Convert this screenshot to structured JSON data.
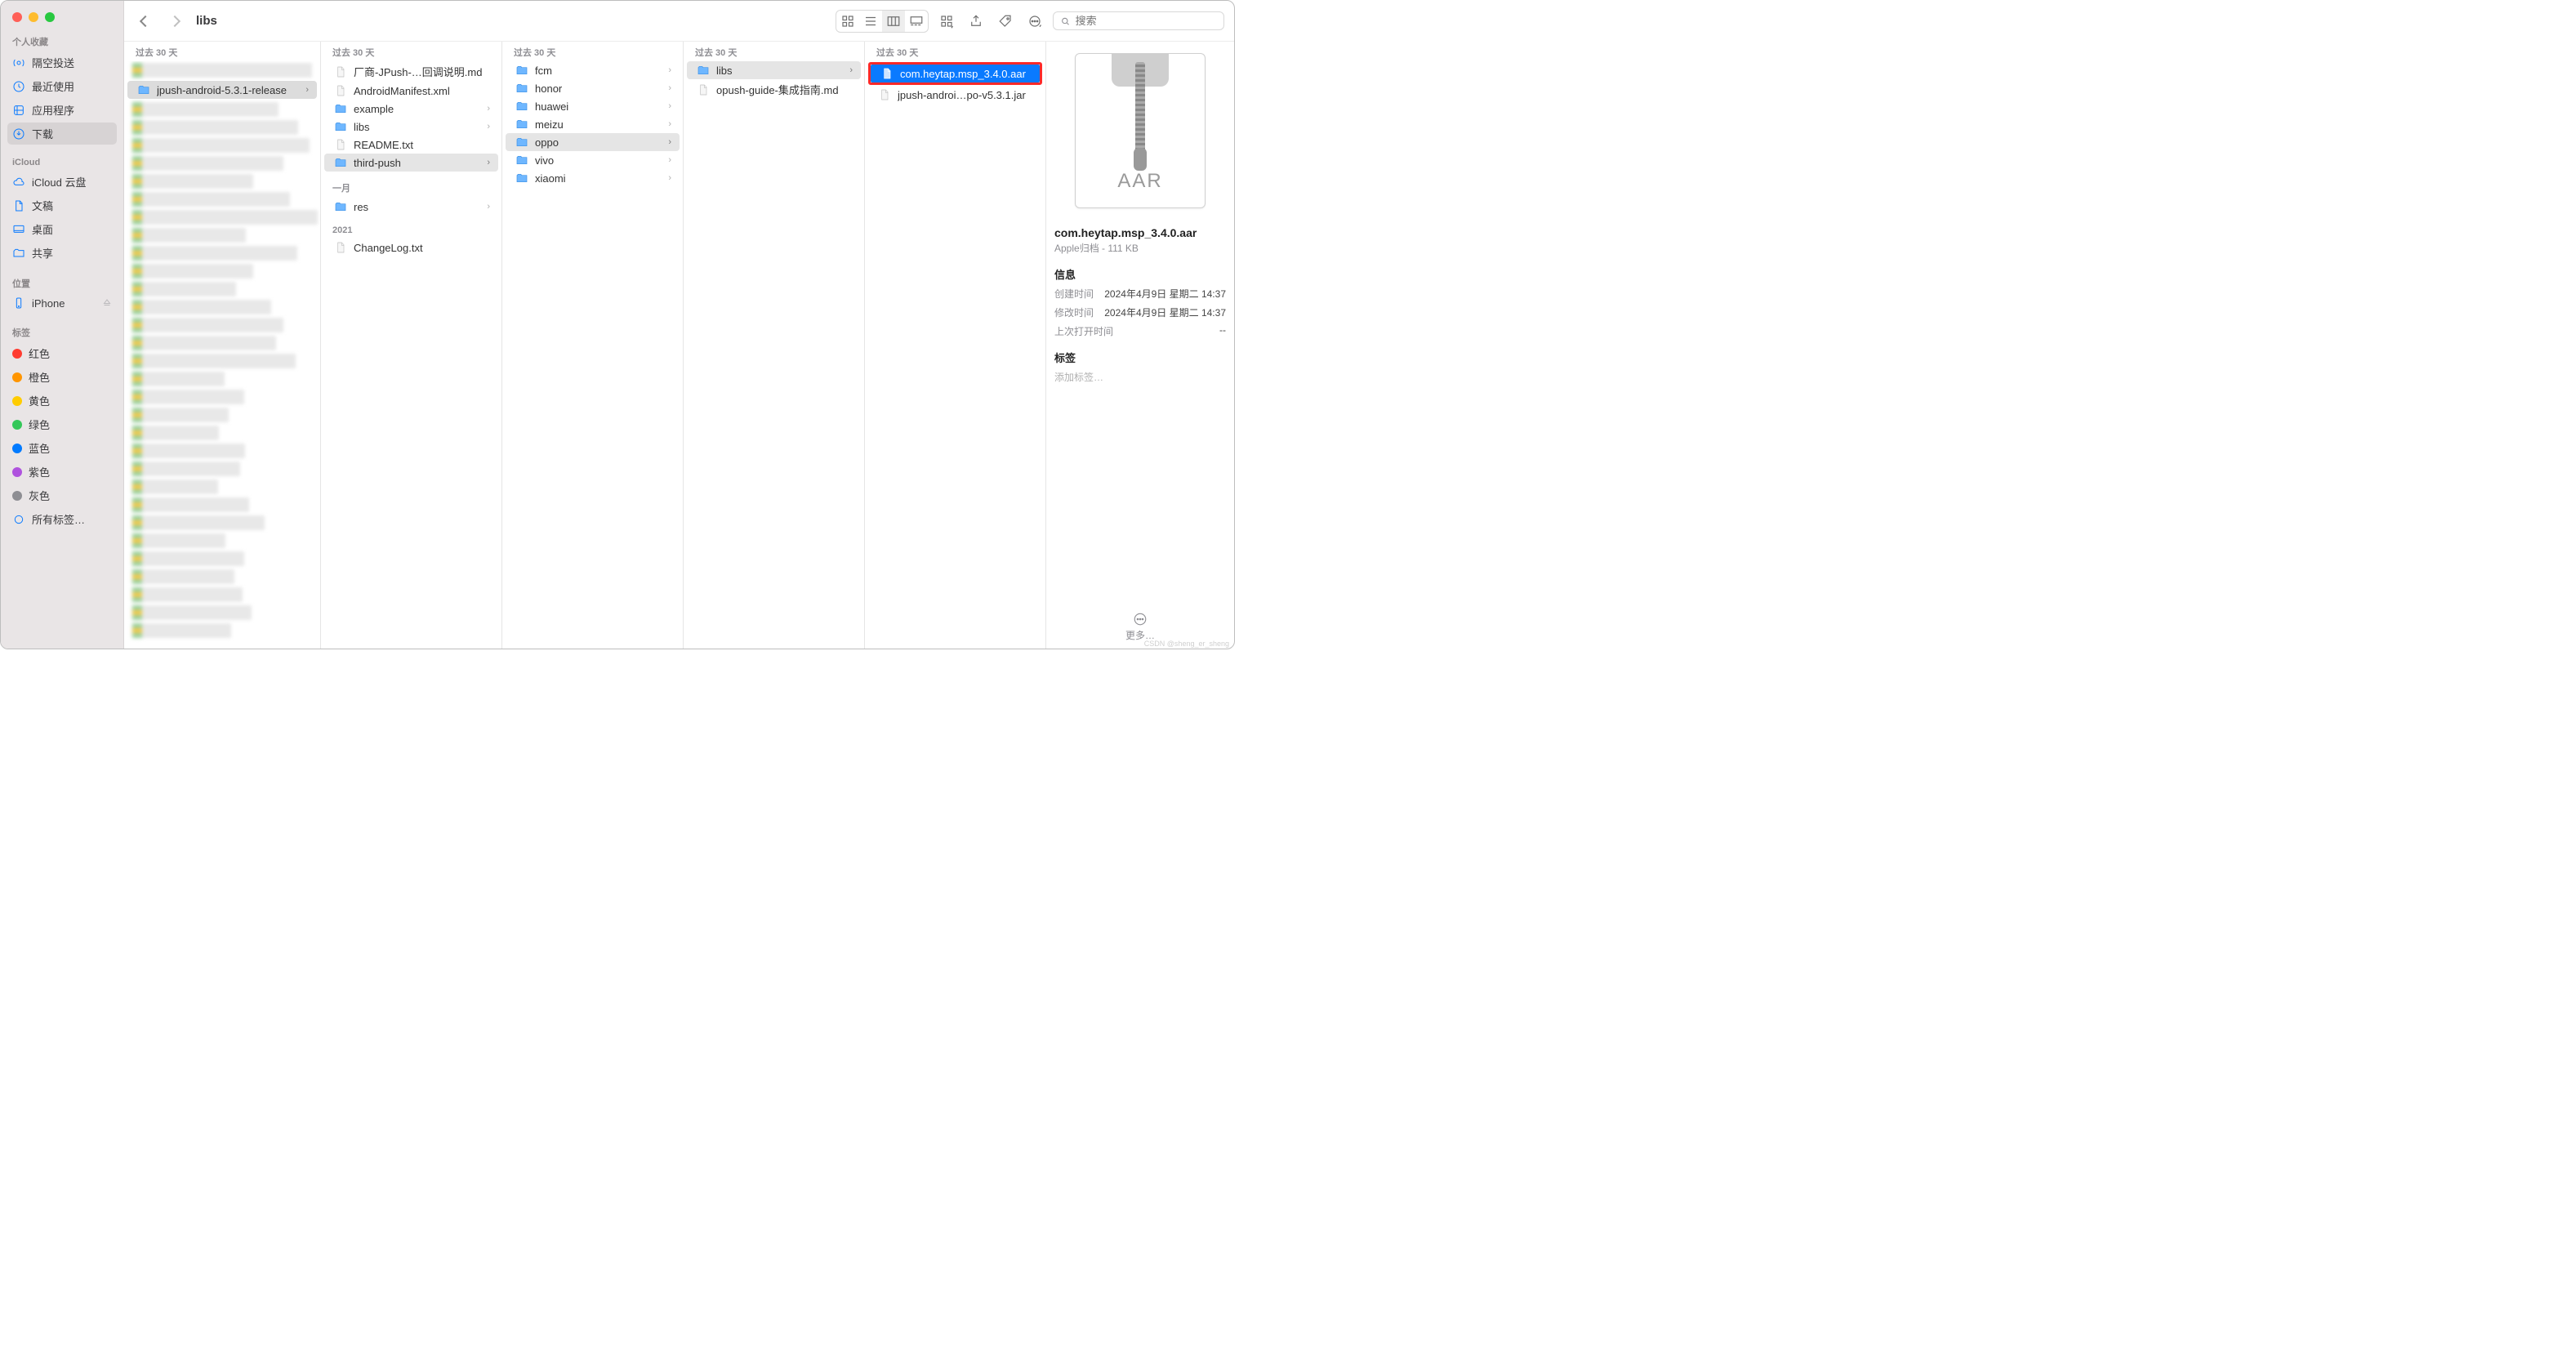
{
  "window_title": "libs",
  "search_placeholder": "搜索",
  "sidebar": {
    "favorites_label": "个人收藏",
    "favorites": [
      {
        "icon": "airdrop",
        "label": "隔空投送"
      },
      {
        "icon": "clock",
        "label": "最近使用"
      },
      {
        "icon": "apps",
        "label": "应用程序"
      },
      {
        "icon": "download",
        "label": "下载",
        "selected": true
      }
    ],
    "icloud_label": "iCloud",
    "icloud": [
      {
        "icon": "cloud",
        "label": "iCloud 云盘"
      },
      {
        "icon": "doc",
        "label": "文稿"
      },
      {
        "icon": "desktop",
        "label": "桌面"
      },
      {
        "icon": "share",
        "label": "共享"
      }
    ],
    "locations_label": "位置",
    "locations": [
      {
        "icon": "phone",
        "label": "iPhone",
        "eject": true
      }
    ],
    "tags_label": "标签",
    "tags": [
      {
        "color": "#ff3b30",
        "label": "红色"
      },
      {
        "color": "#ff9500",
        "label": "橙色"
      },
      {
        "color": "#ffcc00",
        "label": "黄色"
      },
      {
        "color": "#34c759",
        "label": "绿色"
      },
      {
        "color": "#007aff",
        "label": "蓝色"
      },
      {
        "color": "#af52de",
        "label": "紫色"
      },
      {
        "color": "#8e8e93",
        "label": "灰色"
      },
      {
        "color": "",
        "label": "所有标签…",
        "all": true
      }
    ]
  },
  "columns": {
    "c0": {
      "header": "过去 30 天",
      "items": [
        {
          "type": "folder",
          "label": "jpush-android-5.3.1-release",
          "selected": true
        }
      ],
      "blurred_count": 30
    },
    "c1": {
      "header": "过去 30 天",
      "groups": [
        {
          "header": null,
          "items": [
            {
              "type": "file",
              "label": "厂商-JPush-…回调说明.md"
            },
            {
              "type": "file",
              "label": "AndroidManifest.xml"
            },
            {
              "type": "folder",
              "label": "example",
              "chev": true
            },
            {
              "type": "folder",
              "label": "libs",
              "chev": true
            },
            {
              "type": "file",
              "label": "README.txt"
            },
            {
              "type": "folder",
              "label": "third-push",
              "chev": true,
              "selected": true
            }
          ]
        },
        {
          "header": "一月",
          "items": [
            {
              "type": "folder",
              "label": "res",
              "chev": true
            }
          ]
        },
        {
          "header": "2021",
          "items": [
            {
              "type": "file",
              "label": "ChangeLog.txt"
            }
          ]
        }
      ]
    },
    "c2": {
      "header": "过去 30 天",
      "items": [
        {
          "type": "folder",
          "label": "fcm",
          "chev": true
        },
        {
          "type": "folder",
          "label": "honor",
          "chev": true
        },
        {
          "type": "folder",
          "label": "huawei",
          "chev": true
        },
        {
          "type": "folder",
          "label": "meizu",
          "chev": true
        },
        {
          "type": "folder",
          "label": "oppo",
          "chev": true,
          "selected": true
        },
        {
          "type": "folder",
          "label": "vivo",
          "chev": true
        },
        {
          "type": "folder",
          "label": "xiaomi",
          "chev": true
        }
      ]
    },
    "c3": {
      "header": "过去 30 天",
      "items": [
        {
          "type": "folder",
          "label": "libs",
          "chev": true,
          "selected": true
        },
        {
          "type": "file",
          "label": "opush-guide-集成指南.md"
        }
      ]
    },
    "c4": {
      "header": "过去 30 天",
      "items": [
        {
          "type": "file",
          "label": "com.heytap.msp_3.4.0.aar",
          "active": true,
          "highlight": true
        },
        {
          "type": "file",
          "label": "jpush-androi…po-v5.3.1.jar"
        }
      ]
    }
  },
  "preview": {
    "ext": "AAR",
    "name": "com.heytap.msp_3.4.0.aar",
    "kind": "Apple归档 - 111 KB",
    "info_label": "信息",
    "created_label": "创建时间",
    "created_value": "2024年4月9日 星期二 14:37",
    "modified_label": "修改时间",
    "modified_value": "2024年4月9日 星期二 14:37",
    "opened_label": "上次打开时间",
    "opened_value": "--",
    "tags_label": "标签",
    "add_tags": "添加标签…",
    "more": "更多…"
  },
  "watermark": "CSDN @sheng_er_sheng"
}
